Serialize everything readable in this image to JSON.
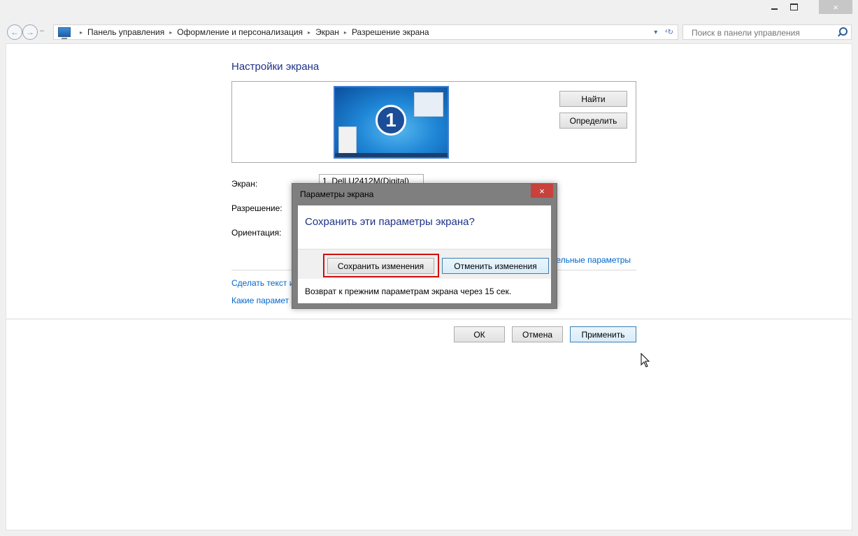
{
  "window": {
    "close_glyph": "×"
  },
  "nav": {
    "back_glyph": "←",
    "forward_glyph": "→",
    "dash": "–",
    "breadcrumbs": [
      "Панель управления",
      "Оформление и персонализация",
      "Экран",
      "Разрешение экрана"
    ],
    "crumb_separator": "▸",
    "dropdown_glyph": "▾",
    "refresh_glyph": "⁴↻"
  },
  "search": {
    "placeholder": "Поиск в панели управления"
  },
  "page": {
    "title": "Настройки экрана",
    "monitor_number": "1",
    "find_button": "Найти",
    "detect_button": "Определить",
    "display_label": "Экран:",
    "display_value": "1. Dell U2412M(Digital)",
    "resolution_label": "Разрешение:",
    "orientation_label": "Ориентация:",
    "advanced_link": "тельные параметры",
    "link_text_size": "Сделать текст и",
    "link_which_params": "Какие парамет",
    "ok_button": "ОК",
    "cancel_button": "Отмена",
    "apply_button": "Применить"
  },
  "dialog": {
    "title": "Параметры экрана",
    "close_glyph": "×",
    "question": "Сохранить эти параметры экрана?",
    "save_button": "Сохранить изменения",
    "revert_button": "Отменить изменения",
    "countdown": "Возврат к прежним параметрам экрана через 15 сек."
  },
  "colors": {
    "accent": "#1e3287",
    "link": "#0066cc",
    "highlight": "#d10f0f",
    "dialog_close": "#c7423d"
  }
}
